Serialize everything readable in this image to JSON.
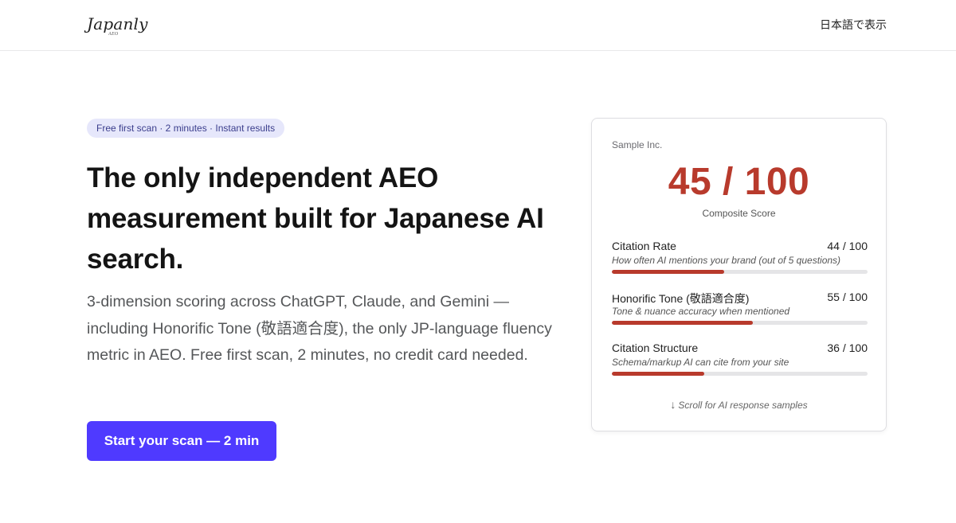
{
  "header": {
    "logo_text": "Japanly",
    "logo_sub": "AEO",
    "lang_link": "日本語で表示"
  },
  "hero": {
    "badge": "Free first scan · 2 minutes · Instant results",
    "headline": "The only independent AEO measurement built for Japanese AI search.",
    "subtext": "3-dimension scoring across ChatGPT, Claude, and Gemini — including Honorific Tone (敬語適合度), the only JP-language fluency metric in AEO. Free first scan, 2 minutes, no credit card needed.",
    "cta_label": "Start your scan — 2 min"
  },
  "sample_card": {
    "company": "Sample Inc.",
    "score": "45 / 100",
    "score_label": "Composite Score",
    "metrics": [
      {
        "title": "Citation Rate",
        "value": "44 / 100",
        "fraction": 0.44,
        "desc": "How often AI mentions your brand (out of 5 questions)"
      },
      {
        "title": "Honorific Tone (敬語適合度)",
        "value": "55 / 100",
        "fraction": 0.55,
        "desc": "Tone & nuance accuracy when mentioned"
      },
      {
        "title": "Citation Structure",
        "value": "36 / 100",
        "fraction": 0.36,
        "desc": "Schema/markup AI can cite from your site"
      }
    ],
    "scroll_hint": "Scroll for AI response samples",
    "scroll_icon": "down-arrow-icon"
  },
  "colors": {
    "accent": "#4f3aff",
    "score_red": "#b83a2c",
    "badge_bg": "#e6e7fb"
  }
}
